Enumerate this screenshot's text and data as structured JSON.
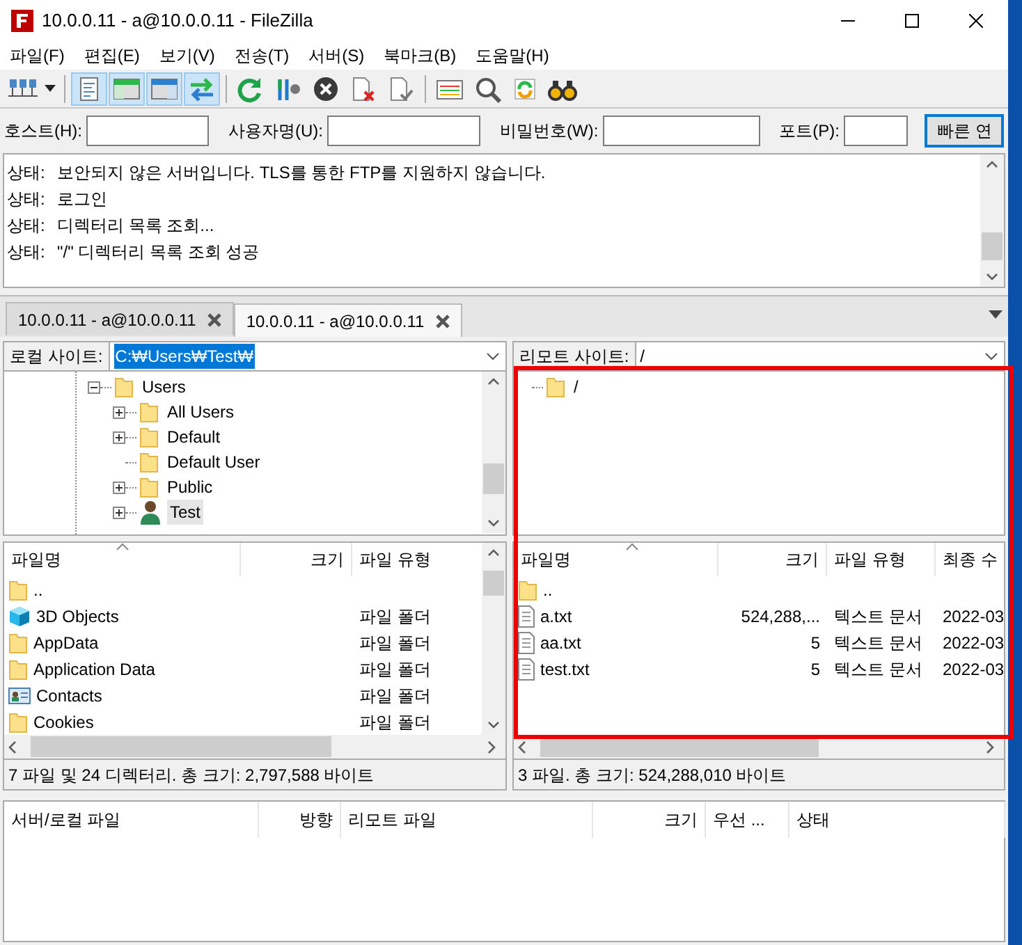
{
  "window": {
    "title": "10.0.0.11 - a@10.0.0.11 - FileZilla"
  },
  "menu": [
    "파일(F)",
    "편집(E)",
    "보기(V)",
    "전송(T)",
    "서버(S)",
    "북마크(B)",
    "도움말(H)"
  ],
  "toolbar": [
    {
      "kind": "sites",
      "on": false
    },
    {
      "kind": "dropdown",
      "on": false
    },
    {
      "kind": "log",
      "on": true
    },
    {
      "kind": "localtree",
      "on": true
    },
    {
      "kind": "remotetree",
      "on": true
    },
    {
      "kind": "queue",
      "on": true
    },
    {
      "kind": "refresh",
      "on": false
    },
    {
      "kind": "filter",
      "on": false
    },
    {
      "kind": "cancel",
      "on": false
    },
    {
      "kind": "disconnect",
      "on": false
    },
    {
      "kind": "reconnect",
      "on": false
    },
    {
      "kind": "compare",
      "on": false
    },
    {
      "kind": "search",
      "on": false
    },
    {
      "kind": "sync",
      "on": false
    },
    {
      "kind": "find",
      "on": false
    }
  ],
  "quickconnect": {
    "fields": [
      {
        "label": "호스트(H):"
      },
      {
        "label": "사용자명(U):"
      },
      {
        "label": "비밀번호(W):"
      },
      {
        "label": "포트(P):"
      }
    ],
    "button": "빠른 연"
  },
  "log": [
    {
      "label": "상태:",
      "message": "보안되지 않은 서버입니다. TLS를 통한 FTP를 지원하지 않습니다."
    },
    {
      "label": "상태:",
      "message": "로그인"
    },
    {
      "label": "상태:",
      "message": "디렉터리 목록 조회..."
    },
    {
      "label": "상태:",
      "message": "\"/\" 디렉터리 목록 조회 성공"
    }
  ],
  "tabs": [
    {
      "label": "10.0.0.11 - a@10.0.0.11",
      "selected": false
    },
    {
      "label": "10.0.0.11 - a@10.0.0.11",
      "selected": true
    }
  ],
  "local": {
    "site_label": "로컬 사이트:",
    "path": "C:₩Users₩Test₩",
    "tree": [
      {
        "name": "Users",
        "kind": "folder",
        "expanded": true,
        "selected": false,
        "children": [
          {
            "name": "All Users",
            "kind": "folder",
            "expanded": false,
            "selected": false
          },
          {
            "name": "Default",
            "kind": "folder",
            "expanded": false,
            "selected": false
          },
          {
            "name": "Default User",
            "kind": "leaf",
            "selected": false
          },
          {
            "name": "Public",
            "kind": "folder",
            "expanded": false,
            "selected": false
          },
          {
            "name": "Test",
            "kind": "user",
            "expanded": false,
            "selected": true
          }
        ]
      }
    ],
    "columns": [
      "파일명",
      "크기",
      "파일 유형"
    ],
    "rows": [
      {
        "kind": "folder",
        "cells": [
          "..",
          "",
          ""
        ]
      },
      {
        "kind": "cube",
        "cells": [
          "3D Objects",
          "",
          "파일 폴더"
        ]
      },
      {
        "kind": "folder",
        "cells": [
          "AppData",
          "",
          "파일 폴더"
        ]
      },
      {
        "kind": "folder",
        "cells": [
          "Application Data",
          "",
          "파일 폴더"
        ]
      },
      {
        "kind": "contacts",
        "cells": [
          "Contacts",
          "",
          "파일 폴더"
        ]
      },
      {
        "kind": "folder",
        "cells": [
          "Cookies",
          "",
          "파일 폴더"
        ]
      }
    ],
    "status": "7 파일 및 24 디렉터리. 총 크기: 2,797,588 바이트"
  },
  "remote": {
    "site_label": "리모트 사이트:",
    "path": "/",
    "tree": [
      {
        "name": "/",
        "kind": "leaf",
        "selected": false
      }
    ],
    "columns": [
      "파일명",
      "크기",
      "파일 유형",
      "최종 수"
    ],
    "rows": [
      {
        "kind": "folder",
        "cells": [
          "..",
          "",
          "",
          ""
        ]
      },
      {
        "kind": "file",
        "cells": [
          "a.txt",
          "524,288,...",
          "텍스트 문서",
          "2022-03"
        ]
      },
      {
        "kind": "file",
        "cells": [
          "aa.txt",
          "5",
          "텍스트 문서",
          "2022-03"
        ]
      },
      {
        "kind": "file",
        "cells": [
          "test.txt",
          "5",
          "텍스트 문서",
          "2022-03"
        ]
      }
    ],
    "status": "3 파일. 총 크기: 524,288,010 바이트"
  },
  "queue": {
    "columns": [
      "서버/로컬 파일",
      "방향",
      "리모트 파일",
      "크기",
      "우선 ...",
      "상태"
    ]
  }
}
